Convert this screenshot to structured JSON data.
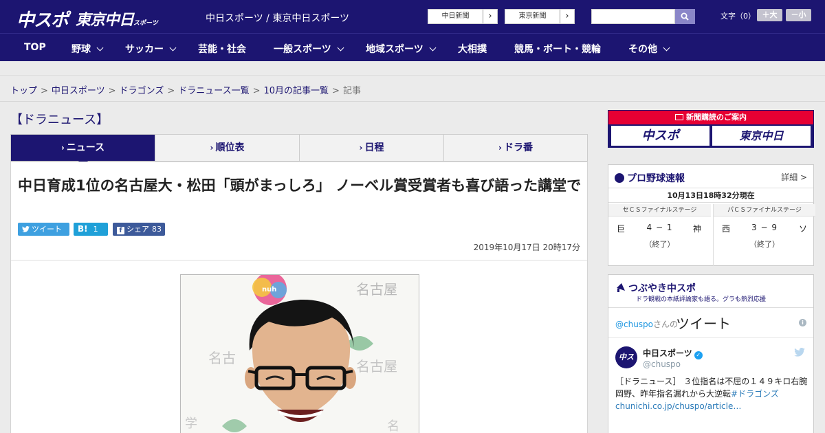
{
  "header": {
    "logo_chuspo": "中スポ",
    "logo_tokyo": "東京中日",
    "logo_tokyo_small": "スポーツ",
    "site_title": "中日スポーツ / 東京中日スポーツ",
    "paper_links": [
      {
        "label": "中日新聞",
        "arrow": "›"
      },
      {
        "label": "東京新聞",
        "arrow": "›"
      }
    ],
    "search_placeholder": "",
    "font_size": {
      "label": "文字（0）",
      "plus": "＋大",
      "minus": "－小"
    }
  },
  "nav": {
    "items": [
      {
        "label": "TOP",
        "has_menu": false
      },
      {
        "label": "野球",
        "has_menu": true
      },
      {
        "label": "サッカー",
        "has_menu": true
      },
      {
        "label": "芸能・社会",
        "has_menu": false
      },
      {
        "label": "一般スポーツ",
        "has_menu": true
      },
      {
        "label": "地域スポーツ",
        "has_menu": true
      },
      {
        "label": "大相撲",
        "has_menu": false
      },
      {
        "label": "競馬・ボート・競輪",
        "has_menu": false
      },
      {
        "label": "その他",
        "has_menu": true
      }
    ]
  },
  "breadcrumb": {
    "items": [
      "トップ",
      "中日スポーツ",
      "ドラゴンズ",
      "ドラニュース一覧",
      "10月の記事一覧"
    ],
    "current": "記事",
    "separator": ">"
  },
  "main": {
    "category_title": "【ドラニュース】",
    "tabs": [
      {
        "label": "ニュース",
        "active": true
      },
      {
        "label": "順位表",
        "active": false
      },
      {
        "label": "日程",
        "active": false
      },
      {
        "label": "ドラ番",
        "active": false
      }
    ],
    "article": {
      "headline": "中日育成1位の名古屋大・松田「頭がまっしろ」 ノーベル賞受賞者も喜び語った講堂で",
      "share": {
        "tweet_label": "ツイート",
        "hatena_label": "B!",
        "hatena_count": "1",
        "facebook_label": "シェア",
        "facebook_count": "83"
      },
      "published": "2019年10月17日 20時17分"
    }
  },
  "sidebar": {
    "ad": {
      "top_text": "新聞購読のご案内",
      "logo1": "中スポ",
      "logo2": "東京中日"
    },
    "scoreboard": {
      "title": "プロ野球速報",
      "detail_link": "詳細 >",
      "as_of": "10月13日18時32分現在",
      "games": [
        {
          "stage": "セＣＳファイナルステージ",
          "home": "巨",
          "score": "4 − 1",
          "away": "神",
          "status": "（終了）"
        },
        {
          "stage": "パＣＳファイナルステージ",
          "home": "西",
          "score": "3 − 9",
          "away": "ソ",
          "status": "（終了）"
        }
      ]
    },
    "twitter": {
      "title": "つぶやき中スポ",
      "subtitle": "ドラ観戦の本紙評論家も語る。グラも熱烈応援",
      "handle": "@chuspo",
      "handle_suffix": "さんの",
      "timeline_label": "ツイート",
      "tweet": {
        "avatar_text": "中スポ",
        "name": "中日スポーツ",
        "user": "@chuspo",
        "text_plain": "［ドラニュース］ ３位指名は不屈の１４９キロ右腕　岡野、昨年指名漏れから大逆転",
        "text_link": "#ドラゴンズ",
        "text_url": "chunichi.co.jp/chuspo/article…"
      }
    }
  },
  "colors": {
    "brand_navy": "#1c1571",
    "accent_red": "#e60033",
    "twitter_blue": "#3ea0e0",
    "hatena_blue": "#1fa0d8",
    "facebook_blue": "#3d5a9a"
  }
}
